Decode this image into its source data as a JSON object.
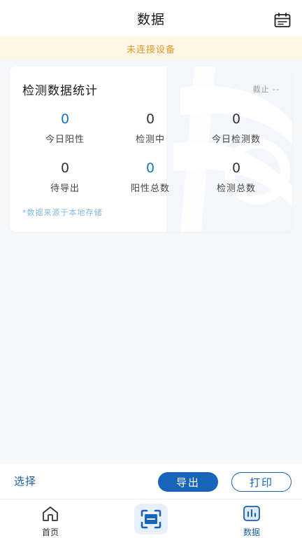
{
  "header": {
    "title": "数据"
  },
  "banner": {
    "status": "未连接设备"
  },
  "stats": {
    "title": "检测数据统计",
    "as_of": "截止 --",
    "items": [
      {
        "value": "0",
        "label": "今日阳性"
      },
      {
        "value": "0",
        "label": "检测中"
      },
      {
        "value": "0",
        "label": "今日检测数"
      },
      {
        "value": "0",
        "label": "待导出"
      },
      {
        "value": "0",
        "label": "阳性总数"
      },
      {
        "value": "0",
        "label": "检测总数"
      }
    ],
    "note": "*数据来源于本地存储"
  },
  "actions": {
    "select": "选择",
    "export": "导出",
    "print": "打印"
  },
  "nav": {
    "home": "首页",
    "data": "数据"
  },
  "colors": {
    "primary": "#1764b8",
    "banner_bg": "#fdf6e4",
    "banner_text": "#e1992b",
    "highlight_value": "#1a73c4"
  },
  "icons": {
    "header_right": "calendar-icon",
    "nav_home": "home-icon",
    "nav_scan": "scan-icon",
    "nav_data": "chart-icon"
  }
}
